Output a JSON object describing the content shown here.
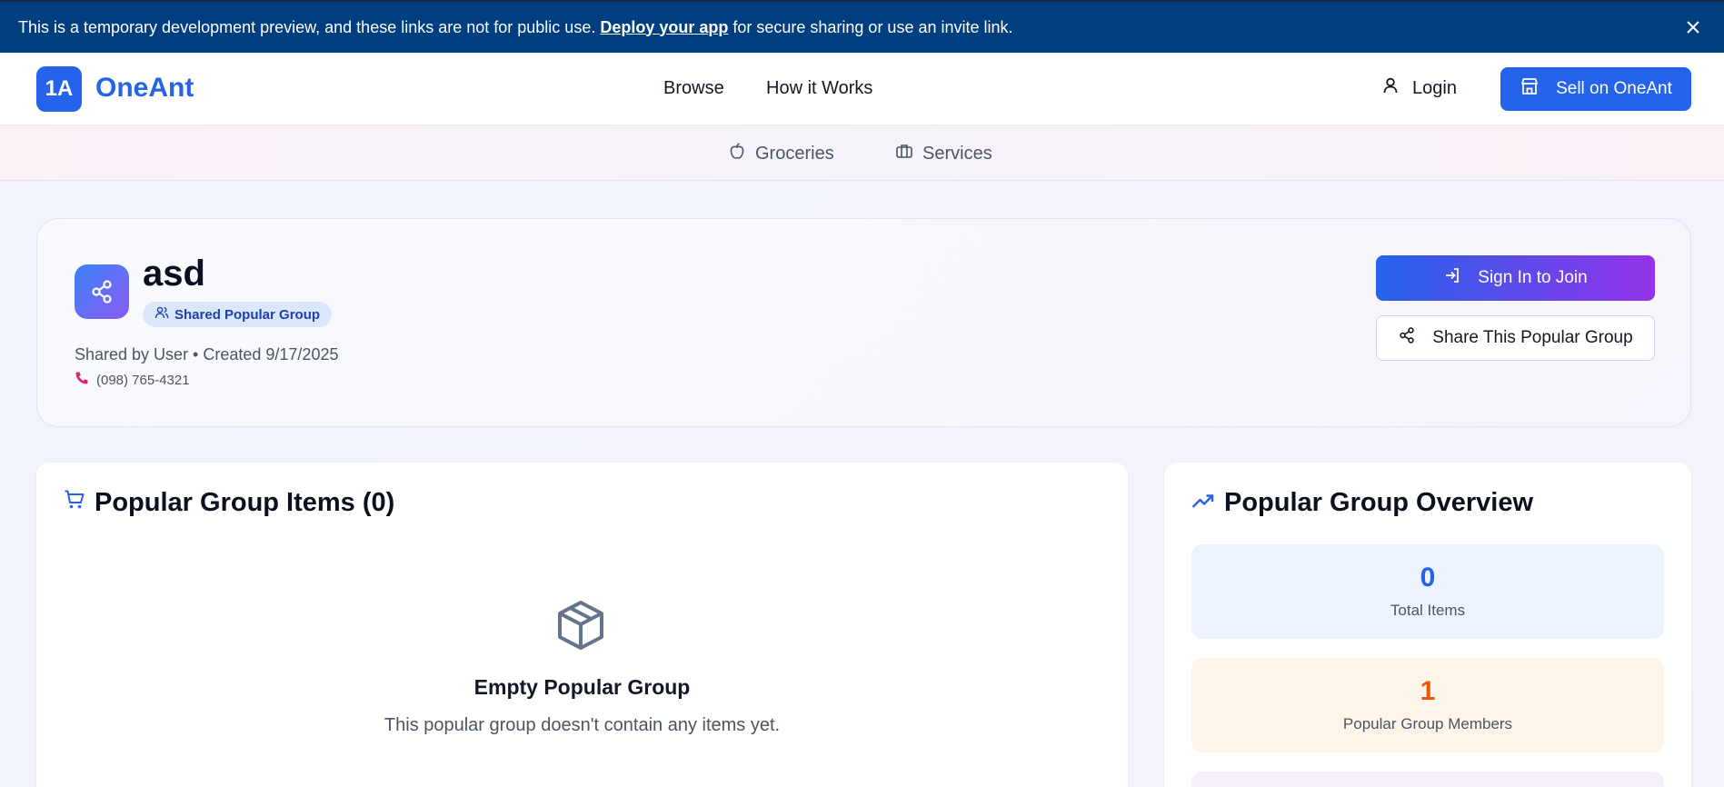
{
  "banner": {
    "text_before": "This is a temporary development preview, and these links are not for public use.",
    "link_text": "Deploy your app",
    "text_after": "for secure sharing or use an invite link."
  },
  "header": {
    "logo_mark": "1A",
    "logo_text": "OneAnt",
    "nav": [
      "Browse",
      "How it Works"
    ],
    "login_label": "Login",
    "sell_label": "Sell on OneAnt"
  },
  "categories": [
    "Groceries",
    "Services"
  ],
  "group": {
    "name": "asd",
    "badge": "Shared Popular Group",
    "meta": "Shared by User • Created 9/17/2025",
    "phone": "(098) 765-4321",
    "sign_in_label": "Sign In to Join",
    "share_label": "Share This Popular Group"
  },
  "items_panel": {
    "title": "Popular Group Items (0)",
    "empty_title": "Empty Popular Group",
    "empty_subtitle": "This popular group doesn't contain any items yet."
  },
  "overview": {
    "title": "Popular Group Overview",
    "stats": [
      {
        "value": "0",
        "label": "Total Items",
        "bg": "#eef4fe",
        "color": "#2563eb"
      },
      {
        "value": "1",
        "label": "Popular Group Members",
        "bg": "#fdf4ea",
        "color": "#ea580c"
      }
    ]
  },
  "colors": {
    "primary": "#2563eb",
    "banner": "#003f7f",
    "accent_purple": "#9333ea",
    "phone_icon": "#db2777"
  }
}
